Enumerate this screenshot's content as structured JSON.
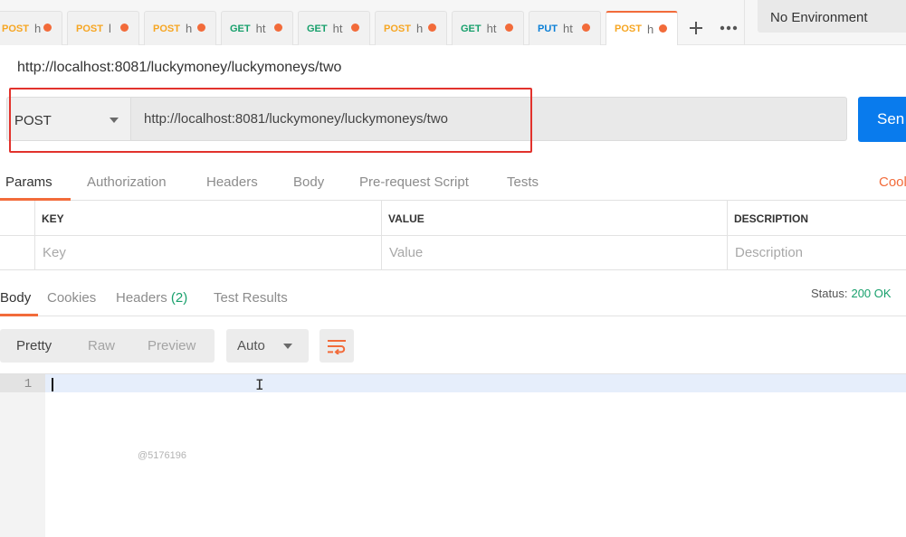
{
  "tabs": [
    {
      "method": "POST",
      "name": "h",
      "method_class": "post"
    },
    {
      "method": "POST",
      "name": "l",
      "method_class": "post"
    },
    {
      "method": "POST",
      "name": "h",
      "method_class": "post"
    },
    {
      "method": "GET",
      "name": "ht",
      "method_class": "get"
    },
    {
      "method": "GET",
      "name": "ht",
      "method_class": "get"
    },
    {
      "method": "POST",
      "name": "h",
      "method_class": "post"
    },
    {
      "method": "GET",
      "name": "ht",
      "method_class": "get"
    },
    {
      "method": "PUT",
      "name": "ht",
      "method_class": "put"
    },
    {
      "method": "POST",
      "name": "h",
      "method_class": "post"
    }
  ],
  "tabbar": {
    "add_icon": "plus-icon",
    "more_icon": "ellipsis-icon"
  },
  "environment": {
    "label": "No Environment"
  },
  "request": {
    "title": "http://localhost:8081/luckymoney/luckymoneys/two",
    "method": "POST",
    "url": "http://localhost:8081/luckymoney/luckymoneys/two",
    "send_label": "Sen"
  },
  "request_tabs": {
    "params": "Params",
    "authorization": "Authorization",
    "headers": "Headers",
    "body": "Body",
    "pre_request": "Pre-request Script",
    "tests": "Tests",
    "cookies": "Cool"
  },
  "params_table": {
    "headers": {
      "key": "KEY",
      "value": "VALUE",
      "description": "DESCRIPTION"
    },
    "placeholders": {
      "key": "Key",
      "value": "Value",
      "description": "Description"
    }
  },
  "response": {
    "tabs": {
      "body": "Body",
      "cookies": "Cookies",
      "headers": "Headers",
      "headers_count": "(2)",
      "test_results": "Test Results"
    },
    "status_label": "Status:",
    "status_value": "200 OK",
    "formats": {
      "pretty": "Pretty",
      "raw": "Raw",
      "preview": "Preview"
    },
    "auto_label": "Auto",
    "wrap_icon": "wrap-lines-icon",
    "line_number": "1",
    "watermark": "@5176196"
  },
  "colors": {
    "accent": "#f26b3a",
    "send": "#097bed",
    "success": "#18a06c",
    "highlight": "#e2322c"
  }
}
